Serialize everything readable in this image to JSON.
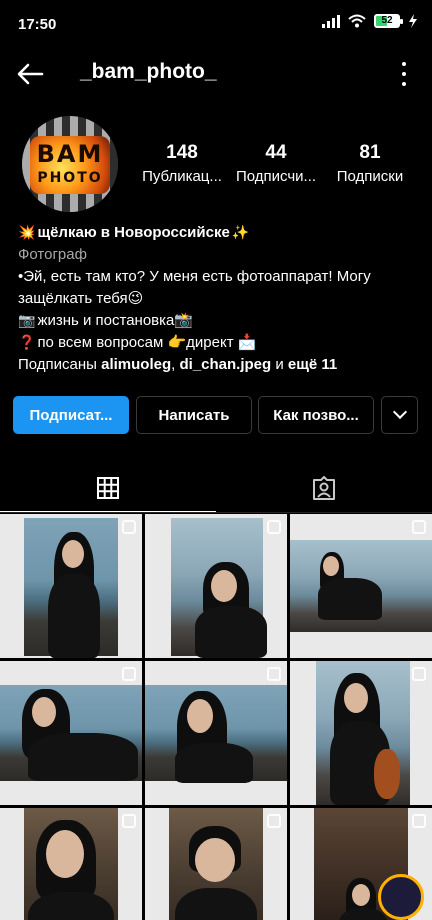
{
  "status": {
    "time": "17:50",
    "battery": "52",
    "battery_fraction": 0.52
  },
  "header": {
    "username": "_bam_photo_"
  },
  "avatar": {
    "line1": "BAM",
    "line2": "PHOTO"
  },
  "stats": [
    {
      "value": "148",
      "label": "Публикац..."
    },
    {
      "value": "44",
      "label": "Подписчи..."
    },
    {
      "value": "81",
      "label": "Подписки"
    }
  ],
  "bio": {
    "name_emoji": "💥",
    "name": "щёлкаю в Новороссийске",
    "name_emoji_end": "✨",
    "category": "Фотограф",
    "line1": "•Эй, есть там кто? У меня есть фотоаппарат! Могу",
    "line2": "защёлкать тебя😉",
    "line3_emoji": "📷",
    "line3": " жизнь и постановка📸",
    "line4_emoji": "❓",
    "line4": "по всем вопросам 👉директ 📩",
    "followed_prefix": "Подписаны ",
    "followed_user1": "alimuoleg",
    "followed_sep": ", ",
    "followed_user2": "di_chan.jpeg",
    "followed_and": " и ",
    "followed_more": "ещё 11"
  },
  "buttons": {
    "follow": "Подписат...",
    "message": "Написать",
    "contact": "Как позво..."
  },
  "tabs": [
    {
      "icon": "grid-icon"
    },
    {
      "icon": "tagged-icon"
    }
  ],
  "grid": {
    "count": 9
  }
}
